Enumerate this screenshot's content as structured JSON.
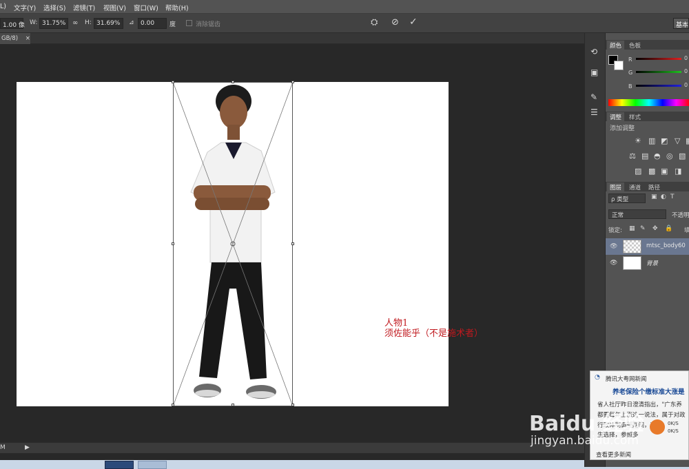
{
  "menubar": {
    "items": [
      "L)",
      "文字(Y)",
      "选择(S)",
      "滤镜(T)",
      "视图(V)",
      "窗口(W)",
      "帮助(H)"
    ]
  },
  "options_bar": {
    "x_value": "1.00 像",
    "w_label": "W:",
    "w_value": "31.75%",
    "h_label": "H:",
    "h_value": "31.69%",
    "angle_value": "0.00",
    "angle_unit": "度",
    "antialias_label": "消除锯齿",
    "workspace_label": "基本"
  },
  "doc_tab": {
    "label": "GB/8)",
    "close": "×"
  },
  "canvas": {
    "annotation_line1": "人物1",
    "annotation_line2": "须佐能乎（不是施术者）"
  },
  "status": {
    "zoom": "M"
  },
  "color_panel": {
    "tabs": [
      "颜色",
      "色板"
    ],
    "channels": [
      {
        "label": "R",
        "value": "0",
        "color": "#e02020"
      },
      {
        "label": "G",
        "value": "0",
        "color": "#1ec01e"
      },
      {
        "label": "B",
        "value": "0",
        "color": "#2020e0"
      }
    ]
  },
  "adjust_panel": {
    "tabs": [
      "调整",
      "样式"
    ],
    "heading": "添加调整"
  },
  "layers_panel": {
    "tabs": [
      "图层",
      "通道",
      "路径"
    ],
    "filter_label": "ρ 类型",
    "blend_mode": "正常",
    "opacity_label": "不透明",
    "lock_label": "锁定:",
    "fill_label": "填",
    "layers": [
      {
        "name": "mtsc_body60",
        "selected": true
      },
      {
        "name": "背景",
        "selected": false
      }
    ]
  },
  "news_popup": {
    "source": "腾讯大粤网新闻",
    "headline": "养老保险个缴标准大涨是",
    "lines": [
      "省人社厅昨日澄清指出，\"广东养",
      "都要每年上涨这一说法，属于对政",
      "行政体制调整期间，适当提高",
      "生选择，参照多"
    ],
    "net_up": "0K/S",
    "net_down": "0K/S",
    "more_link": "查看更多新闻"
  },
  "watermark": {
    "brand": "Baidu 经验",
    "url": "jingyan.baidu.com"
  }
}
